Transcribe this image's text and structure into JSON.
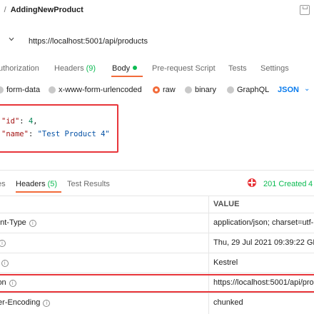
{
  "breadcrumb": {
    "parent": "r",
    "separator": "/",
    "current": "AddingNewProduct"
  },
  "request": {
    "url": "https://localhost:5001/api/products"
  },
  "request_tabs": [
    {
      "label": "uthorization"
    },
    {
      "label": "Headers",
      "count": "(9)"
    },
    {
      "label": "Body"
    },
    {
      "label": "Pre-request Script"
    },
    {
      "label": "Tests"
    },
    {
      "label": "Settings"
    }
  ],
  "body_types": [
    {
      "label": "form-data"
    },
    {
      "label": "x-www-form-urlencoded"
    },
    {
      "label": "raw"
    },
    {
      "label": "binary"
    },
    {
      "label": "GraphQL"
    }
  ],
  "body_format": "JSON",
  "body_lines": [
    {
      "key": "\"id\"",
      "colon": ":",
      "value": "4",
      "trail": ","
    },
    {
      "key": "\"name\"",
      "colon": ":",
      "value": "\"Test Product 4\"",
      "trail": ""
    }
  ],
  "response_tabs": [
    {
      "label": "es"
    },
    {
      "label": "Headers",
      "count": "(5)"
    },
    {
      "label": "Test Results"
    }
  ],
  "status": {
    "text": "201 Created",
    "trail": "4",
    "color": "#0cbb52"
  },
  "headers_table": {
    "value_header": "VALUE",
    "rows": [
      {
        "key": "ent-Type",
        "value": "application/json; charset=utf-"
      },
      {
        "key": "",
        "value": "Thu, 29 Jul 2021 09:39:22 GM"
      },
      {
        "key": "r",
        "value": "Kestrel"
      },
      {
        "key": "ion",
        "value": "https://localhost:5001/api/pro"
      },
      {
        "key": "fer-Encoding",
        "value": "chunked"
      }
    ]
  },
  "colors": {
    "accent": "#f26b3a",
    "highlight_border": "#e8353a",
    "link": "#097bed",
    "ok": "#0cbb52"
  }
}
